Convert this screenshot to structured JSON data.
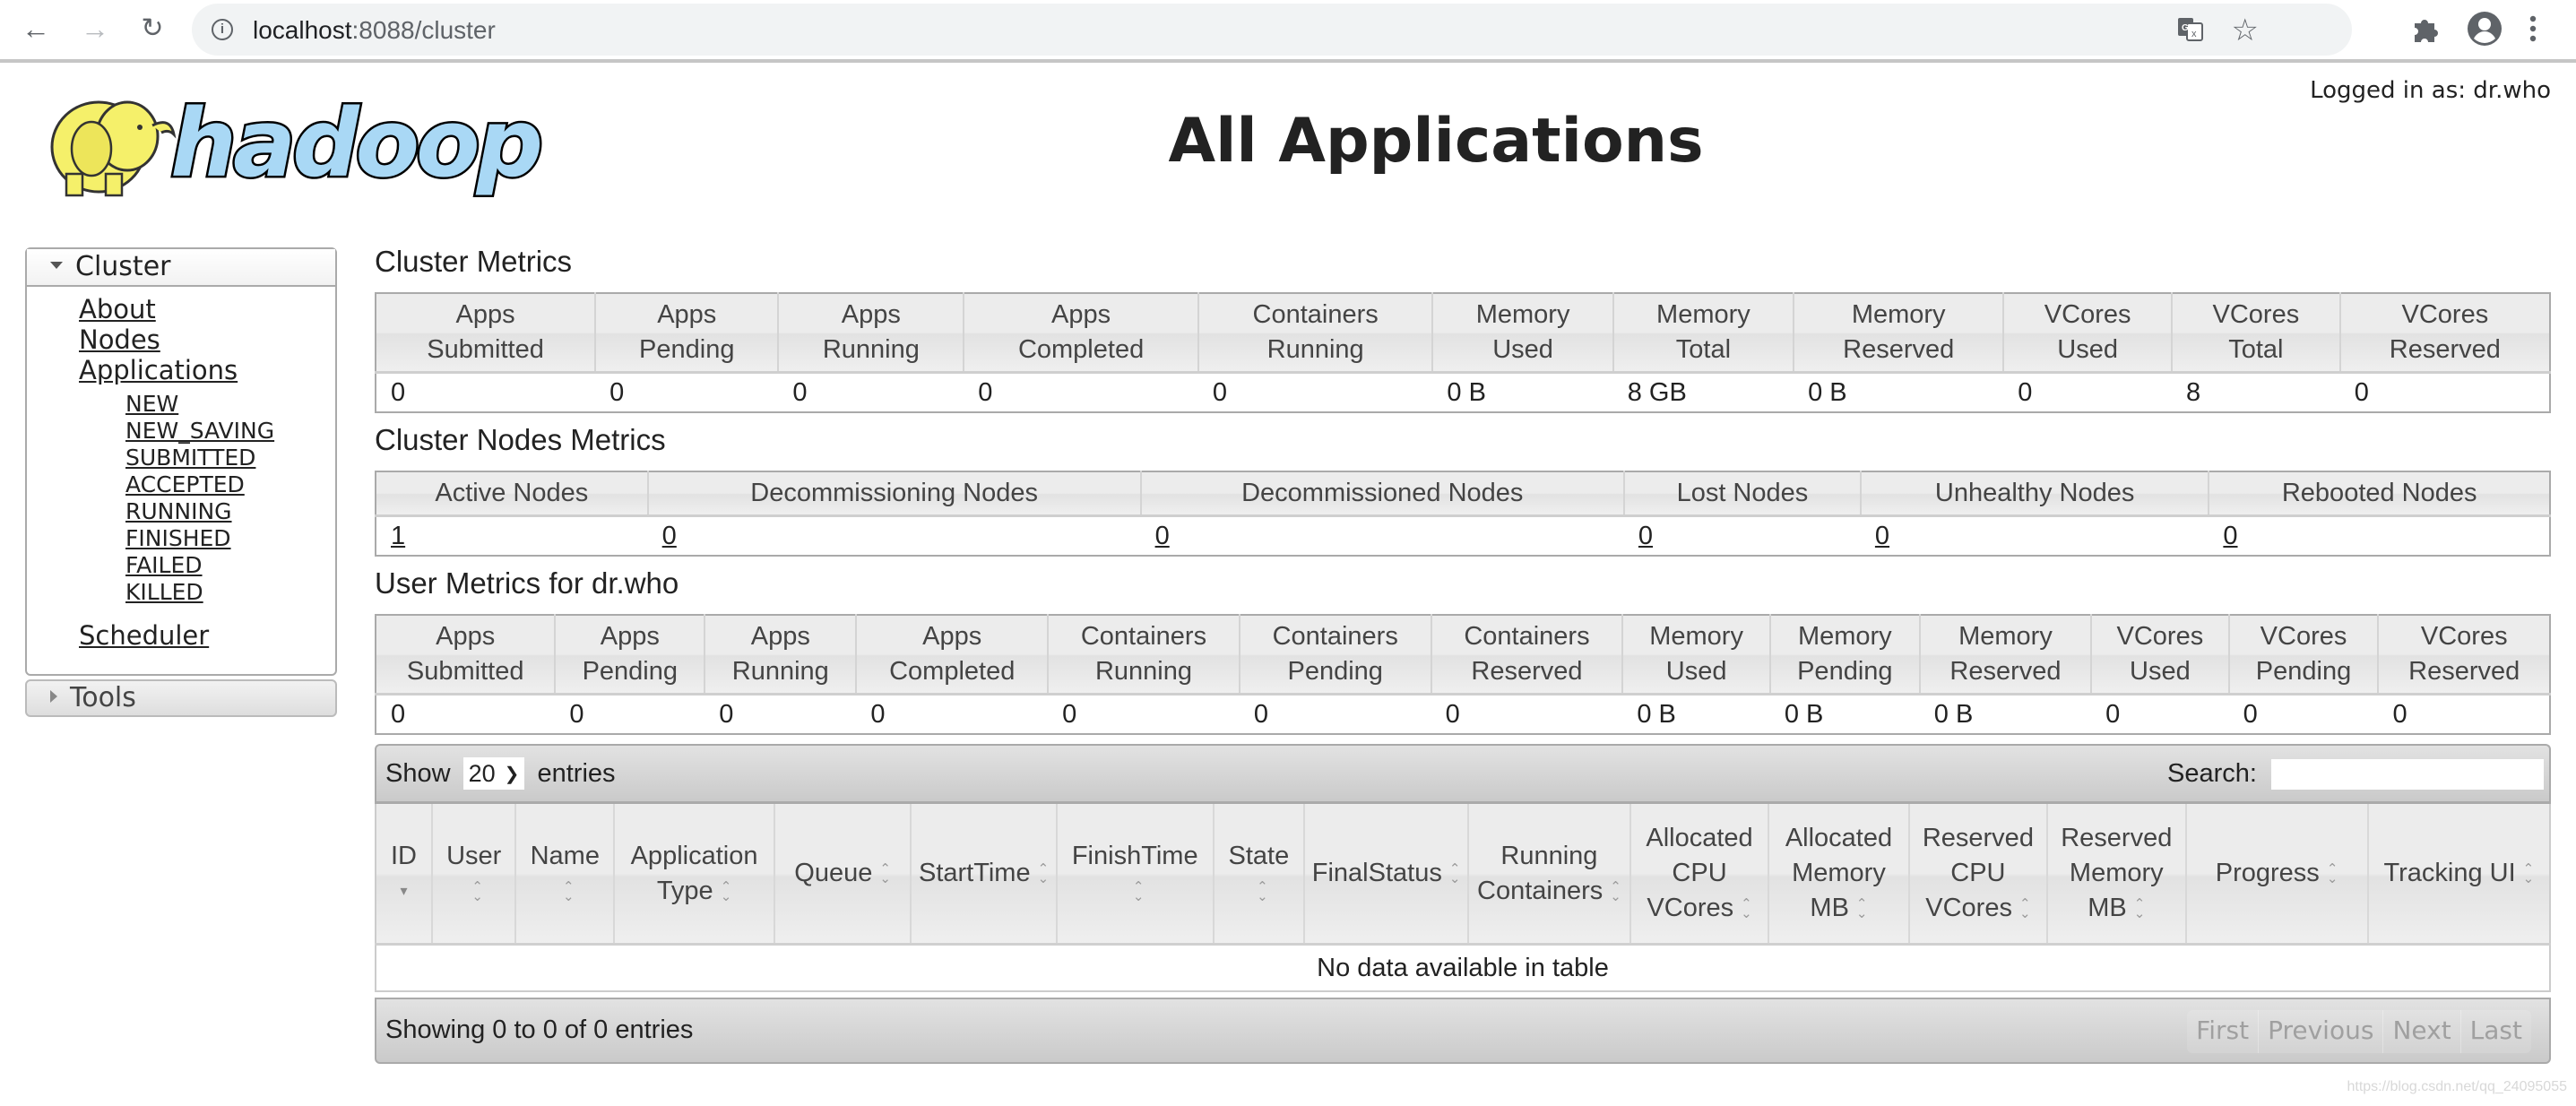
{
  "browser": {
    "url_host": "localhost",
    "url_rest": ":8088/cluster",
    "icons": [
      "back-arrow-icon",
      "forward-arrow-icon",
      "reload-icon",
      "info-icon",
      "translate-icon",
      "star-icon",
      "extensions-icon",
      "profile-icon",
      "menu-icon"
    ]
  },
  "header": {
    "logged_in": "Logged in as: dr.who",
    "title": "All Applications",
    "logo_text": "hadoop"
  },
  "sidebar": {
    "cluster_label": "Cluster",
    "links": [
      "About",
      "Nodes",
      "Applications"
    ],
    "app_states": [
      "NEW",
      "NEW_SAVING",
      "SUBMITTED",
      "ACCEPTED",
      "RUNNING",
      "FINISHED",
      "FAILED",
      "KILLED"
    ],
    "scheduler": "Scheduler",
    "tools_label": "Tools"
  },
  "cluster_metrics": {
    "title": "Cluster Metrics",
    "headers": [
      [
        "Apps",
        "Submitted"
      ],
      [
        "Apps",
        "Pending"
      ],
      [
        "Apps",
        "Running"
      ],
      [
        "Apps",
        "Completed"
      ],
      [
        "Containers",
        "Running"
      ],
      [
        "Memory",
        "Used"
      ],
      [
        "Memory",
        "Total"
      ],
      [
        "Memory",
        "Reserved"
      ],
      [
        "VCores",
        "Used"
      ],
      [
        "VCores",
        "Total"
      ],
      [
        "VCores",
        "Reserved"
      ]
    ],
    "values": [
      "0",
      "0",
      "0",
      "0",
      "0",
      "0 B",
      "8 GB",
      "0 B",
      "0",
      "8",
      "0"
    ]
  },
  "node_metrics": {
    "title": "Cluster Nodes Metrics",
    "headers": [
      "Active Nodes",
      "Decommissioning Nodes",
      "Decommissioned Nodes",
      "Lost Nodes",
      "Unhealthy Nodes",
      "Rebooted Nodes"
    ],
    "values": [
      "1",
      "0",
      "0",
      "0",
      "0",
      "0"
    ]
  },
  "user_metrics": {
    "title": "User Metrics for dr.who",
    "headers": [
      [
        "Apps",
        "Submitted"
      ],
      [
        "Apps",
        "Pending"
      ],
      [
        "Apps",
        "Running"
      ],
      [
        "Apps",
        "Completed"
      ],
      [
        "Containers",
        "Running"
      ],
      [
        "Containers",
        "Pending"
      ],
      [
        "Containers",
        "Reserved"
      ],
      [
        "Memory",
        "Used"
      ],
      [
        "Memory",
        "Pending"
      ],
      [
        "Memory",
        "Reserved"
      ],
      [
        "VCores",
        "Used"
      ],
      [
        "VCores",
        "Pending"
      ],
      [
        "VCores",
        "Reserved"
      ]
    ],
    "values": [
      "0",
      "0",
      "0",
      "0",
      "0",
      "0",
      "0",
      "0 B",
      "0 B",
      "0 B",
      "0",
      "0",
      "0"
    ]
  },
  "apps_table": {
    "show_label": "Show",
    "page_size": "20",
    "entries_label": "entries",
    "search_label": "Search:",
    "search_value": "",
    "columns": [
      {
        "label": "ID",
        "sort": "desc"
      },
      {
        "label": "User",
        "sort": "both"
      },
      {
        "label": "Name",
        "sort": "both"
      },
      {
        "label": "Application Type",
        "sort": "both"
      },
      {
        "label": "Queue",
        "sort": "both"
      },
      {
        "label": "StartTime",
        "sort": "both"
      },
      {
        "label": "FinishTime",
        "sort": "both"
      },
      {
        "label": "State",
        "sort": "both"
      },
      {
        "label": "FinalStatus",
        "sort": "both"
      },
      {
        "label": "Running Containers",
        "sort": "both"
      },
      {
        "label": "Allocated CPU VCores",
        "sort": "both"
      },
      {
        "label": "Allocated Memory MB",
        "sort": "both"
      },
      {
        "label": "Reserved CPU VCores",
        "sort": "both"
      },
      {
        "label": "Reserved Memory MB",
        "sort": "both"
      },
      {
        "label": "Progress",
        "sort": "both"
      },
      {
        "label": "Tracking UI",
        "sort": "both"
      }
    ],
    "empty_message": "No data available in table",
    "info": "Showing 0 to 0 of 0 entries",
    "pager": [
      "First",
      "Previous",
      "Next",
      "Last"
    ]
  },
  "watermark": "https://blog.csdn.net/qq_24095055",
  "colors": {
    "header_bg": "#ececec",
    "toolbar_bg": "#d6d6d6",
    "logo_text_fill": "#a9d8f5",
    "logo_elephant": "#f5f06a",
    "pager_disabled": "#a0a0a0"
  }
}
